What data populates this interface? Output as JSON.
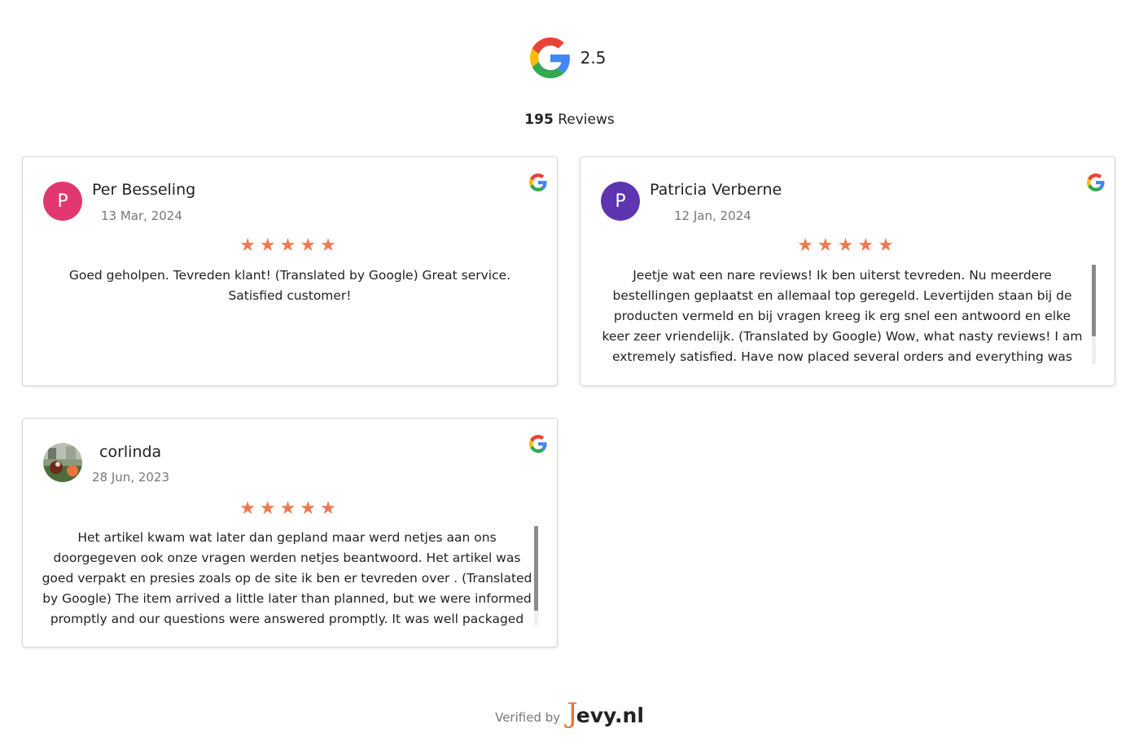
{
  "summary": {
    "rating": "2.5",
    "review_count": "195",
    "review_label": "Reviews"
  },
  "reviews": [
    {
      "author": "Per Besseling",
      "initial": "P",
      "date": "13 Mar, 2024",
      "stars": "★★★★★",
      "text": "Goed geholpen. Tevreden klant! (Translated by Google) Great service. Satisfied customer!",
      "avatar_color": "#e0376f"
    },
    {
      "author": "Patricia Verberne",
      "initial": "P",
      "date": "12 Jan, 2024",
      "stars": "★★★★★",
      "text": "Jeetje wat een nare reviews! Ik ben uiterst tevreden. Nu meerdere bestellingen geplaatst en allemaal top geregeld. Levertijden staan bij de producten vermeld en bij vragen kreeg ik erg snel een antwoord en elke keer zeer vriendelijk. (Translated by Google) Wow, what nasty reviews! I am extremely satisfied. Have now placed several orders and everything was arranged perfectly. Delivery times are stated on the products and when I had questions I received an answer very quickly and every time very friendly.",
      "avatar_color": "#5e35b1"
    },
    {
      "author": "corlinda",
      "date": "28 Jun, 2023",
      "stars": "★★★★★",
      "text": "Het artikel kwam wat later dan gepland maar werd netjes aan ons doorgegeven ook onze vragen werden netjes beantwoord. Het artikel was goed verpakt en presies zoals op de site ik ben er tevreden over . (Translated by Google) The item arrived a little later than planned, but we were informed promptly and our questions were answered promptly. It was well packaged and exactly as described on the website."
    }
  ],
  "footer": {
    "verified_label": "Verified by",
    "brand_mark": "J",
    "brand_text": "evy.nl",
    "brand_color": "#e8743b"
  },
  "colors": {
    "star": "#ec7a4f",
    "google_blue": "#4285F4",
    "google_red": "#EA4335",
    "google_yellow": "#FBBC05",
    "google_green": "#34A853"
  }
}
